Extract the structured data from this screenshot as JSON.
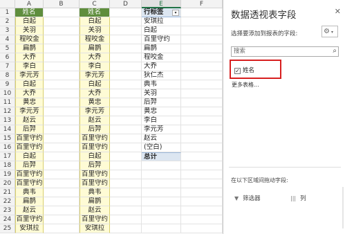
{
  "sheet": {
    "columns": [
      "A",
      "B",
      "C",
      "D",
      "E",
      "F"
    ],
    "selected_column": "E",
    "row_numbers": [
      "1",
      "2",
      "3",
      "4",
      "5",
      "6",
      "7",
      "8",
      "9",
      "10",
      "11",
      "12",
      "13",
      "14",
      "15",
      "16",
      "17",
      "18",
      "19",
      "20",
      "21",
      "22",
      "23",
      "24",
      "25"
    ],
    "col_a": [
      "姓名",
      "白起",
      "关羽",
      "程咬金",
      "扁鹊",
      "大乔",
      "李白",
      "李元芳",
      "白起",
      "大乔",
      "黄忠",
      "李元芳",
      "赵云",
      "后羿",
      "百里守约",
      "百里守约",
      "白起",
      "后羿",
      "百里守约",
      "百里守约",
      "典韦",
      "扁鹊",
      "赵云",
      "百里守约",
      "安琪拉"
    ],
    "col_c": [
      "姓名",
      "白起",
      "关羽",
      "程咬金",
      "扁鹊",
      "大乔",
      "李白",
      "李元芳",
      "白起",
      "大乔",
      "黄忠",
      "李元芳",
      "赵云",
      "后羿",
      "百里守约",
      "百里守约",
      "白起",
      "后羿",
      "百里守约",
      "百里守约",
      "典韦",
      "扁鹊",
      "赵云",
      "百里守约",
      "安琪拉"
    ],
    "pivot_header": "行标签",
    "pivot_items": [
      "安琪拉",
      "白起",
      "百里守约",
      "扁鹊",
      "程咬金",
      "大乔",
      "狄仁杰",
      "典韦",
      "关羽",
      "后羿",
      "黄忠",
      "李白",
      "李元芳",
      "赵云",
      "(空白)"
    ],
    "pivot_total": "总计",
    "dropdown_glyph": "▾"
  },
  "pane": {
    "title": "数据透视表字段",
    "close_glyph": "✕",
    "subtitle": "选择要添加到报表的字段:",
    "gear_glyph": "⚙",
    "gear_caret": "▾",
    "search_placeholder": "搜索",
    "search_glyph": "⌕",
    "field_checked_glyph": "✓",
    "field_label": "姓名",
    "more_tables": "更多表格...",
    "drag_hint": "在以下区域间拖动字段:",
    "filter_icon_glyph": "▼",
    "filter_label": "筛选器",
    "columns_icon_glyph": "|||",
    "columns_label": "列",
    "highlight_color": "#d71e1e",
    "header_green": "#5f8e3d"
  }
}
